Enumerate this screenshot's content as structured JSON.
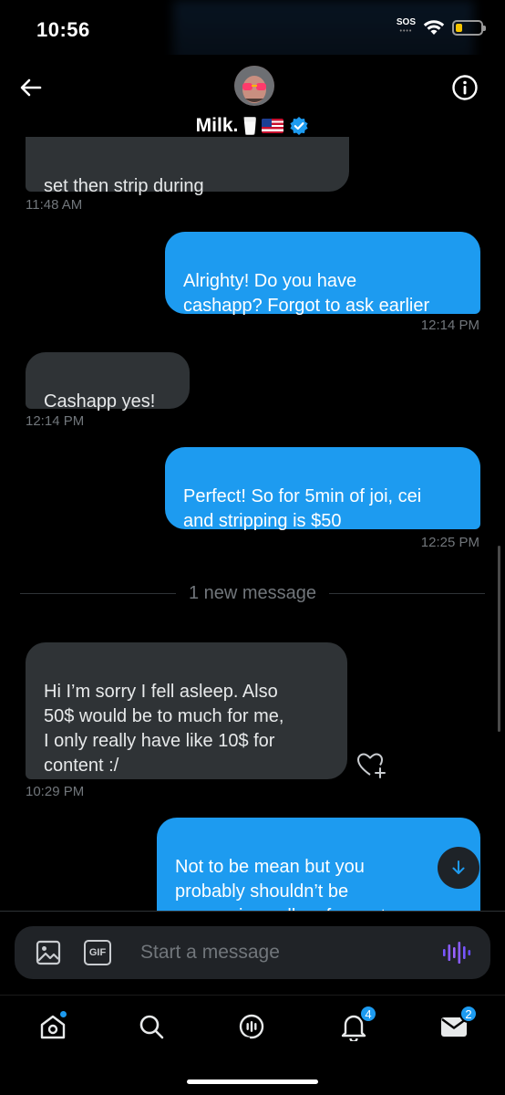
{
  "status_bar": {
    "time": "10:56",
    "sos": "SOS"
  },
  "header": {
    "name": "Milk.",
    "back_icon": "arrow-left-icon",
    "info_icon": "info-icon",
    "verified": true
  },
  "messages": [
    {
      "direction": "in",
      "text": "set then strip during",
      "time": "11:48 AM"
    },
    {
      "direction": "out",
      "text": "Alrighty! Do you have\ncashapp? Forgot to ask earlier",
      "time": "12:14 PM"
    },
    {
      "direction": "in",
      "text": "Cashapp yes!",
      "time": "12:14 PM"
    },
    {
      "direction": "out",
      "text": "Perfect! So for 5min of joi, cei\nand stripping is $50",
      "time": "12:25 PM"
    },
    {
      "direction": "in",
      "text": "Hi I’m sorry I fell asleep. Also\n50$ would be to much for me,\nI only really have like 10$ for\ncontent :/",
      "time": "10:29 PM"
    },
    {
      "direction": "out",
      "text": "Not to be mean but you\nprobably shouldn’t be\nmessaging sellers for customs",
      "time": ""
    }
  ],
  "divider": {
    "label": "1 new message"
  },
  "composer": {
    "placeholder": "Start a message",
    "gif_label": "GIF"
  },
  "tabbar": {
    "items": [
      {
        "name": "home",
        "icon": "home-icon",
        "badge": ""
      },
      {
        "name": "search",
        "icon": "search-icon",
        "badge": ""
      },
      {
        "name": "spaces",
        "icon": "spaces-icon",
        "badge": ""
      },
      {
        "name": "notifications",
        "icon": "bell-icon",
        "badge": "4"
      },
      {
        "name": "messages",
        "icon": "mail-icon",
        "badge": "2"
      }
    ]
  },
  "colors": {
    "accent": "#1d9bf0",
    "incoming_bubble": "#2f3336",
    "background": "#000000",
    "timestamp": "#71767b"
  }
}
